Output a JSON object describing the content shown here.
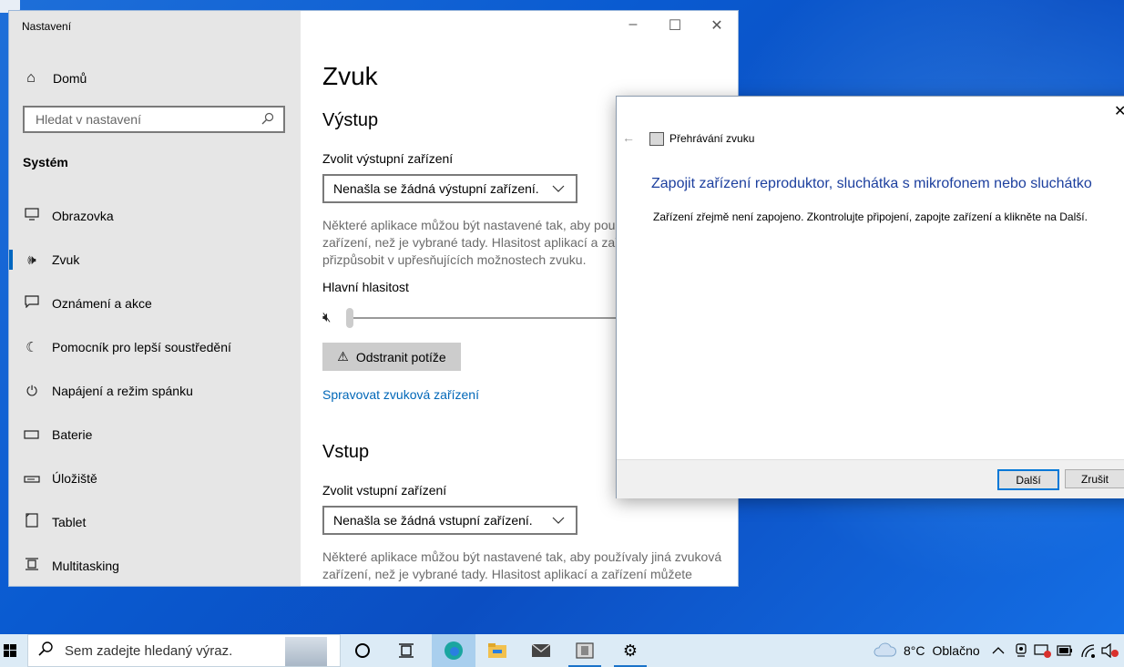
{
  "settings": {
    "app_title": "Nastavení",
    "home": "Domů",
    "search_placeholder": "Hledat v nastavení",
    "section": "Systém",
    "nav_items": [
      {
        "label": "Obrazovka",
        "icon": "monitor-icon"
      },
      {
        "label": "Zvuk",
        "icon": "speaker-icon"
      },
      {
        "label": "Oznámení a akce",
        "icon": "notification-icon"
      },
      {
        "label": "Pomocník pro lepší soustředění",
        "icon": "moon-icon"
      },
      {
        "label": "Napájení a režim spánku",
        "icon": "power-icon"
      },
      {
        "label": "Baterie",
        "icon": "battery-icon"
      },
      {
        "label": "Úložiště",
        "icon": "storage-icon"
      },
      {
        "label": "Tablet",
        "icon": "tablet-icon"
      },
      {
        "label": "Multitasking",
        "icon": "multitasking-icon"
      }
    ],
    "active_item": "Zvuk",
    "page_title": "Zvuk",
    "output": {
      "heading": "Výstup",
      "device_label": "Zvolit výstupní zařízení",
      "device_value": "Nenašla se žádná výstupní zařízení.",
      "description_lines": [
        "Některé aplikace můžou být nastavené tak, aby použí",
        "zařízení, než je vybrané tady. Hlasitost aplikací a zaří",
        "přizpůsobit v upřesňujících možnostech zvuku."
      ],
      "volume_label": "Hlavní hlasitost",
      "volume_level": 0,
      "troubleshoot_button": "Odstranit potíže",
      "manage_link": "Spravovat zvuková zařízení"
    },
    "input": {
      "heading": "Vstup",
      "device_label": "Zvolit vstupní zařízení",
      "device_value": "Nenašla se žádná vstupní zařízení.",
      "description_lines": [
        "Některé aplikace můžou být nastavené tak, aby používaly jiná zvuková",
        "zařízení, než je vybrané tady. Hlasitost aplikací a zařízení můžete"
      ]
    }
  },
  "dialog": {
    "app_title": "Přehrávání zvuku",
    "heading": "Zapojit zařízení reproduktor, sluchátka s mikrofonem nebo sluchátko",
    "text": "Zařízení zřejmě není zapojeno. Zkontrolujte připojení, zapojte zařízení a klikněte na Další.",
    "next_button": "Další",
    "cancel_button": "Zrušit"
  },
  "taskbar": {
    "search_placeholder": "Sem zadejte hledaný výraz.",
    "weather_temp": "8°C",
    "weather_text": "Oblačno",
    "accent_color": "#0067c0"
  }
}
